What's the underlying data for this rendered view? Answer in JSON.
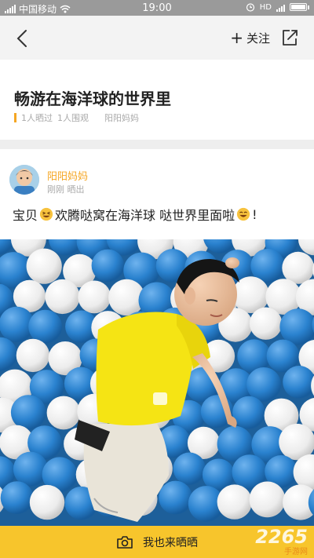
{
  "status_bar": {
    "carrier": "中国移动",
    "time": "19:00",
    "hd_label": "HD"
  },
  "nav": {
    "back_icon": "chevron-left-icon",
    "follow_label": "关注",
    "share_icon": "share-icon"
  },
  "post": {
    "title": "畅游在海洋球的世界里",
    "stats": {
      "shared": "1人晒过",
      "viewed": "1人围观",
      "author_tag": "阳阳妈妈"
    }
  },
  "entry": {
    "author": "阳阳妈妈",
    "time": "刚刚 晒出",
    "caption_part1": "宝贝",
    "caption_part2": "欢腾哒窝在海洋球 哒世界里面啦",
    "caption_part3": "!"
  },
  "bottom_bar": {
    "label": "我也来晒晒",
    "icon": "camera-icon"
  },
  "watermark": {
    "text": "2265",
    "sub": "手游网"
  },
  "colors": {
    "accent": "#f5a623",
    "bottom_bar": "#f7c52c",
    "ball_blue": "#2d86d3",
    "ball_white": "#f4f4f4"
  }
}
